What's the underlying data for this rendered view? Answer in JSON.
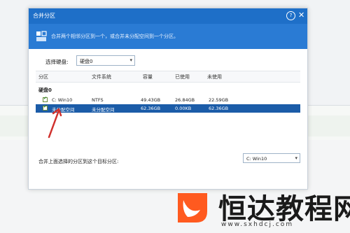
{
  "dialog": {
    "title": "合并分区",
    "help_glyph": "?",
    "close_glyph": "✕",
    "banner_text": "合并两个相邻分区到一个，或合并未分配空间到一个分区。"
  },
  "disk_selector": {
    "label": "选择硬盘:",
    "value": "硬盘0"
  },
  "table": {
    "columns": [
      "分区",
      "文件系统",
      "容量",
      "已使用",
      "未使用"
    ],
    "group": "硬盘0",
    "rows": [
      {
        "name": "C: Win10",
        "fs": "NTFS",
        "capacity": "49.43GB",
        "used": "26.84GB",
        "free": "22.59GB",
        "checked": true,
        "selected": false
      },
      {
        "name": "未分配空间",
        "fs": "未分配空间",
        "capacity": "62.36GB",
        "used": "0.00KB",
        "free": "62.36GB",
        "checked": true,
        "selected": true
      }
    ]
  },
  "merge_target": {
    "label": "合并上面选择的分区到这个目标分区:",
    "value": "C: Win10"
  },
  "watermark": {
    "title": "恒达教程网",
    "url": "www.sxhdcj.com"
  },
  "colors": {
    "titlebar": "#1e6fc8",
    "banner": "#2a7bd4",
    "selected_row": "#1b5ca8",
    "arrow": "#d0312d",
    "logo": "#ff5a1f"
  }
}
